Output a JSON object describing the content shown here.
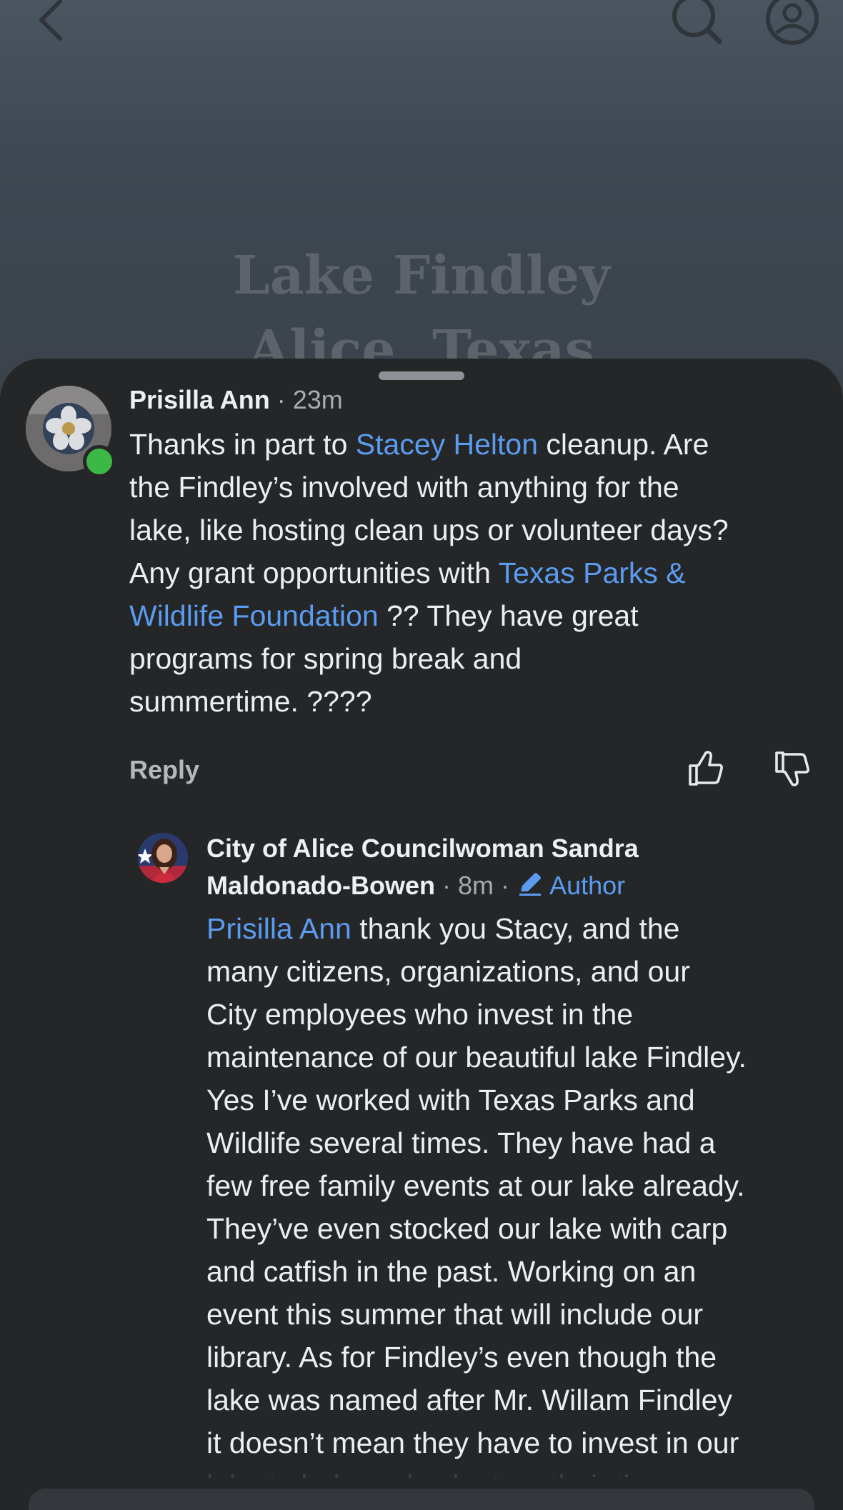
{
  "backdrop": {
    "title_line1": "Lake Findley",
    "title_line2": "Alice, Texas"
  },
  "comment": {
    "author": "Prisilla Ann",
    "separator": "·",
    "time": "23m",
    "lines": [
      [
        {
          "t": "Thanks in part to "
        },
        {
          "t": "Stacey Helton",
          "m": true
        },
        {
          "t": " cleanup. Are"
        }
      ],
      [
        {
          "t": "the Findley’s involved with anything for the"
        }
      ],
      [
        {
          "t": "lake, like hosting clean ups or volunteer days?"
        }
      ],
      [
        {
          "t": "Any grant opportunities with "
        },
        {
          "t": "Texas Parks &",
          "m": true
        }
      ],
      [
        {
          "t": "Wildlife Foundation",
          "m": true
        },
        {
          "t": " ?? They have great"
        }
      ],
      [
        {
          "t": "programs for spring break and"
        }
      ],
      [
        {
          "t": "summertime. ????"
        }
      ]
    ],
    "reply_label": "Reply"
  },
  "reply": {
    "author_line1": "City of Alice Councilwoman Sandra",
    "author_line2": "Maldonado-Bowen",
    "separator": "·",
    "time": "8m",
    "badge": "Author",
    "lines": [
      [
        {
          "t": "Prisilla Ann",
          "m": true
        },
        {
          "t": " thank you Stacy, and the"
        }
      ],
      [
        {
          "t": "many citizens, organizations, and our"
        }
      ],
      [
        {
          "t": "City employees who invest in the"
        }
      ],
      [
        {
          "t": "maintenance of our beautiful lake Findley."
        }
      ],
      [
        {
          "t": "Yes I’ve worked with Texas Parks and"
        }
      ],
      [
        {
          "t": "Wildlife several times. They have had a"
        }
      ],
      [
        {
          "t": "few free family events at our lake already."
        }
      ],
      [
        {
          "t": "They’ve even stocked our lake with carp"
        }
      ],
      [
        {
          "t": "and catfish in the past. Working on an"
        }
      ],
      [
        {
          "t": "event this summer that will include our"
        }
      ],
      [
        {
          "t": "library. As for Findley’s even though the"
        }
      ],
      [
        {
          "t": "lake was named after Mr. Willam Findley"
        }
      ],
      [
        {
          "t": "it doesn’t mean they have to invest in our"
        }
      ],
      [
        {
          "t": "lake to help and volunteer their time."
        }
      ]
    ]
  },
  "icons": {
    "back": "chevron-left-icon",
    "search": "search-icon",
    "profile": "profile-icon",
    "like": "thumbs-up-icon",
    "dislike": "thumbs-down-icon",
    "author": "pencil-icon"
  },
  "colors": {
    "background": "#242628",
    "link": "#5b9cf0",
    "online": "#3cb846"
  }
}
